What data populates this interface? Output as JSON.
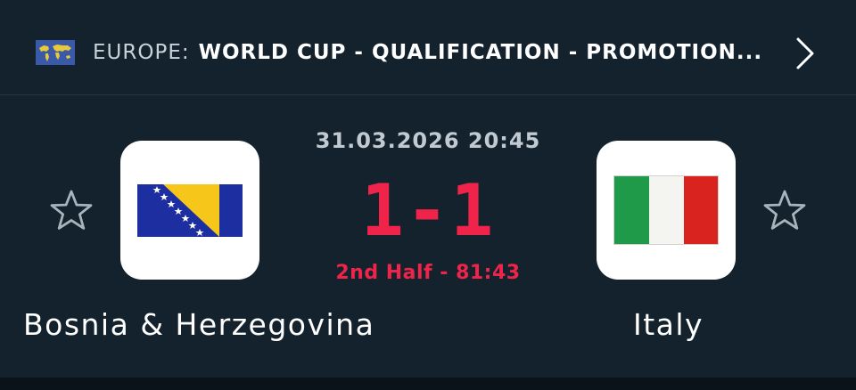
{
  "header": {
    "region_icon": "world-map-flag-icon",
    "region": "EUROPE:",
    "league": "WORLD CUP - QUALIFICATION - PROMOTION...",
    "chevron_icon": "chevron-right-icon"
  },
  "match": {
    "datetime": "31.03.2026 20:45",
    "score": "1-1",
    "status": "2nd Half - 81:43"
  },
  "home_team": {
    "name": "Bosnia & Herzegovina",
    "flag_icon": "bosnia-herzegovina-flag-icon",
    "favorite_icon": "star-outline-icon"
  },
  "away_team": {
    "name": "Italy",
    "flag_icon": "italy-flag-icon",
    "favorite_icon": "star-outline-icon"
  },
  "colors": {
    "background": "#13222d",
    "accent_live": "#f0244a",
    "muted_text": "#c2cad1"
  }
}
